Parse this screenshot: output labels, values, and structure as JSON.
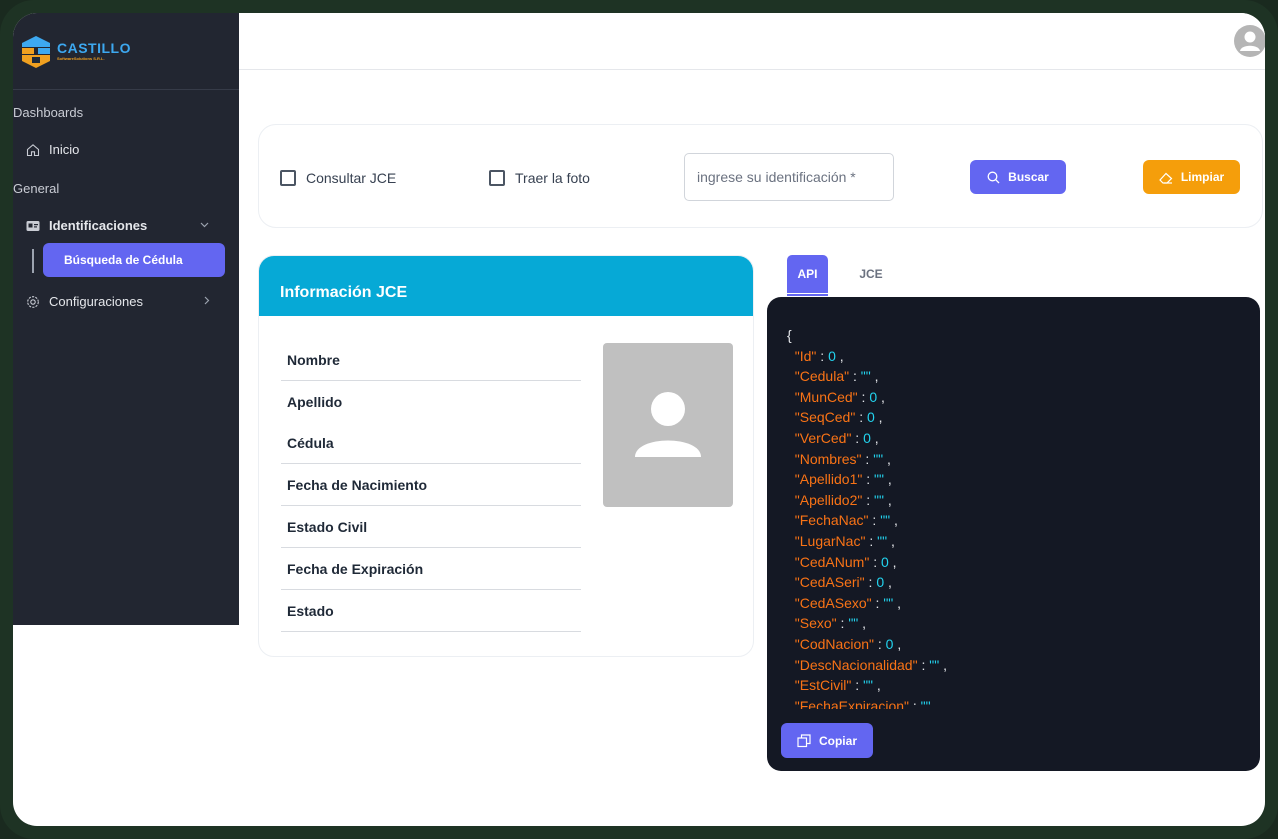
{
  "sidebar": {
    "logo": {
      "name": "CASTILLO",
      "tagline": "SoftwareSolutions S.R.L."
    },
    "sections": {
      "dashboards": "Dashboards",
      "general": "General"
    },
    "items": [
      {
        "label": "Inicio",
        "icon": "home-icon"
      },
      {
        "label": "Identificaciones",
        "icon": "id-card-icon"
      },
      {
        "label": "Búsqueda de Cédula",
        "active": true
      },
      {
        "label": "Configuraciones",
        "icon": "gear-icon"
      }
    ]
  },
  "topbar": {
    "avatar_icon": "user-avatar-icon"
  },
  "search": {
    "check_jce_label": "Consultar JCE",
    "check_photo_label": "Traer la foto",
    "input_placeholder": "ingrese su identificación *",
    "input_value": "",
    "search_button": "Buscar",
    "clear_button": "Limpiar"
  },
  "info": {
    "title": "Información JCE",
    "fields": [
      "Nombre",
      "Apellido",
      "Cédula",
      "Fecha de Nacimiento",
      "Estado Civil",
      "Fecha de Expiración",
      "Estado"
    ],
    "photo_icon": "person-placeholder-icon"
  },
  "tabs": [
    {
      "label": "API",
      "active": true
    },
    {
      "label": "JCE",
      "active": false
    }
  ],
  "json_panel": {
    "open_brace": "{",
    "entries": [
      {
        "key": "\"Id\"",
        "value": "0"
      },
      {
        "key": "\"Cedula\"",
        "value": "\"\""
      },
      {
        "key": "\"MunCed\"",
        "value": "0"
      },
      {
        "key": "\"SeqCed\"",
        "value": "0"
      },
      {
        "key": "\"VerCed\"",
        "value": "0"
      },
      {
        "key": "\"Nombres\"",
        "value": "\"\""
      },
      {
        "key": "\"Apellido1\"",
        "value": "\"\""
      },
      {
        "key": "\"Apellido2\"",
        "value": "\"\""
      },
      {
        "key": "\"FechaNac\"",
        "value": "\"\""
      },
      {
        "key": "\"LugarNac\"",
        "value": "\"\""
      },
      {
        "key": "\"CedANum\"",
        "value": "0"
      },
      {
        "key": "\"CedASeri\"",
        "value": "0"
      },
      {
        "key": "\"CedASexo\"",
        "value": "\"\""
      },
      {
        "key": "\"Sexo\"",
        "value": "\"\""
      },
      {
        "key": "\"CodNacion\"",
        "value": "0"
      },
      {
        "key": "\"DescNacionalidad\"",
        "value": "\"\""
      },
      {
        "key": "\"EstCivil\"",
        "value": "\"\""
      },
      {
        "key": "\"FechaExpiracion\"",
        "value": "\"\""
      }
    ],
    "copy_button": "Copiar"
  },
  "colors": {
    "primary": "#6366f1",
    "warning": "#f59e0b",
    "info_header": "#06a9d6",
    "sidebar_bg": "#222631",
    "code_bg": "#141824",
    "json_key": "#f97316",
    "json_value": "#22d3ee"
  }
}
